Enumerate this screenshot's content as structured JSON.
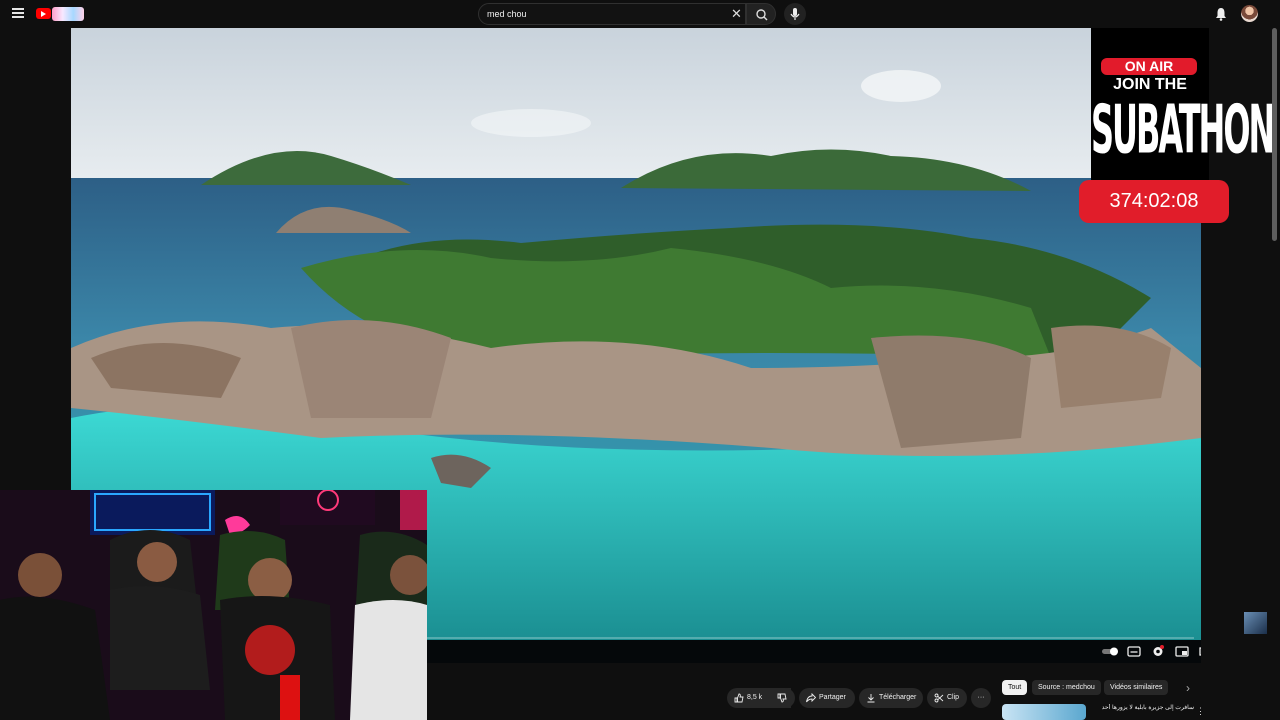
{
  "search": {
    "value": "med chou"
  },
  "stream_overlay": {
    "on_air": "ON AIR",
    "join_the": "JOIN THE",
    "subathon": "SUBATHON",
    "timer": "374:02:08"
  },
  "actions": {
    "likes": "8,5 k",
    "share": "Partager",
    "download": "Télécharger",
    "clip": "Clip",
    "more": "···"
  },
  "chips": {
    "all": "Tout",
    "source": "Source : medchou",
    "similar": "Vidéos similaires"
  },
  "recommendation": {
    "title": "سافرت إلى جزيرة بابلية لا يزورها أحد"
  },
  "icons": {
    "menu": "menu-icon",
    "logo": "youtube-logo",
    "clear": "close-icon",
    "search": "search-icon",
    "mic": "mic-icon",
    "bell": "bell-icon",
    "avatar": "avatar"
  },
  "colors": {
    "accent": "#e11d2a",
    "background": "#0f0f0f",
    "youtube_red": "#ff0000"
  }
}
